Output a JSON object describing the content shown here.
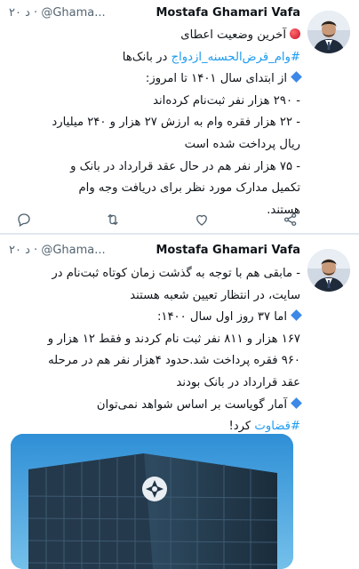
{
  "tweets": [
    {
      "author": {
        "name": "Mostafa Ghamari Vafa",
        "handle": "@Ghama...",
        "time": "۲۰ د",
        "separator": "·"
      },
      "lines": [
        "آخرین وضعیت اعطای",
        "#وام_قرض‌الحسنه_ازدواج در بانک‌ها",
        "از ابتدای سال ۱۴۰۱ تا امروز:",
        "- ۲۹۰ هزار نفر ثبت‌نام کرده‌اند",
        "- ۲۲ هزار فقره وام به ارزش ۲۷ هزار و ۲۴۰ میلیارد",
        "ریال پرداخت شده است",
        "- ۷۵ هزار نفر هم در حال عقد قرارداد در بانک و",
        "تکمیل مدارک مورد نظر برای دریافت وجه وام",
        "هستند."
      ],
      "hashtag": "#وام_قرض‌الحسنه_ازدواج",
      "hashtag_rest": "در بانک‌ها"
    },
    {
      "author": {
        "name": "Mostafa Ghamari Vafa",
        "handle": "@Ghama...",
        "time": "۲۰ د",
        "separator": "·"
      },
      "lines": [
        "- مابقی هم با توجه به گذشت زمان کوتاه ثبت‌نام در",
        "سایت، در انتظار تعیین شعبه هستند",
        "اما ۳۷ روز اول سال ۱۴۰۰:",
        "۱۶۷ هزار و ۸۱۱ نفر ثبت نام کردند و فقط ۱۲ هزار و",
        "۹۶۰ فقره پرداخت شد.حدود ۴هزار نفر هم در مرحله",
        "عقد قرارداد در بانک بودند",
        "آمار گویاست بر اساس شواهد نمی‌توان",
        "#قضاوت کرد!"
      ],
      "hashtag": "#قضاوت",
      "hashtag_rest": "کرد!"
    }
  ],
  "actions": [
    "reply-icon",
    "retweet-icon",
    "like-icon",
    "share-icon"
  ],
  "colors": {
    "hashtag": "#1d9bf0",
    "secondary": "#536471",
    "diamond": "#3b88e8",
    "red_dot": "#c8102e",
    "building_sky": "#3f9ed9"
  }
}
